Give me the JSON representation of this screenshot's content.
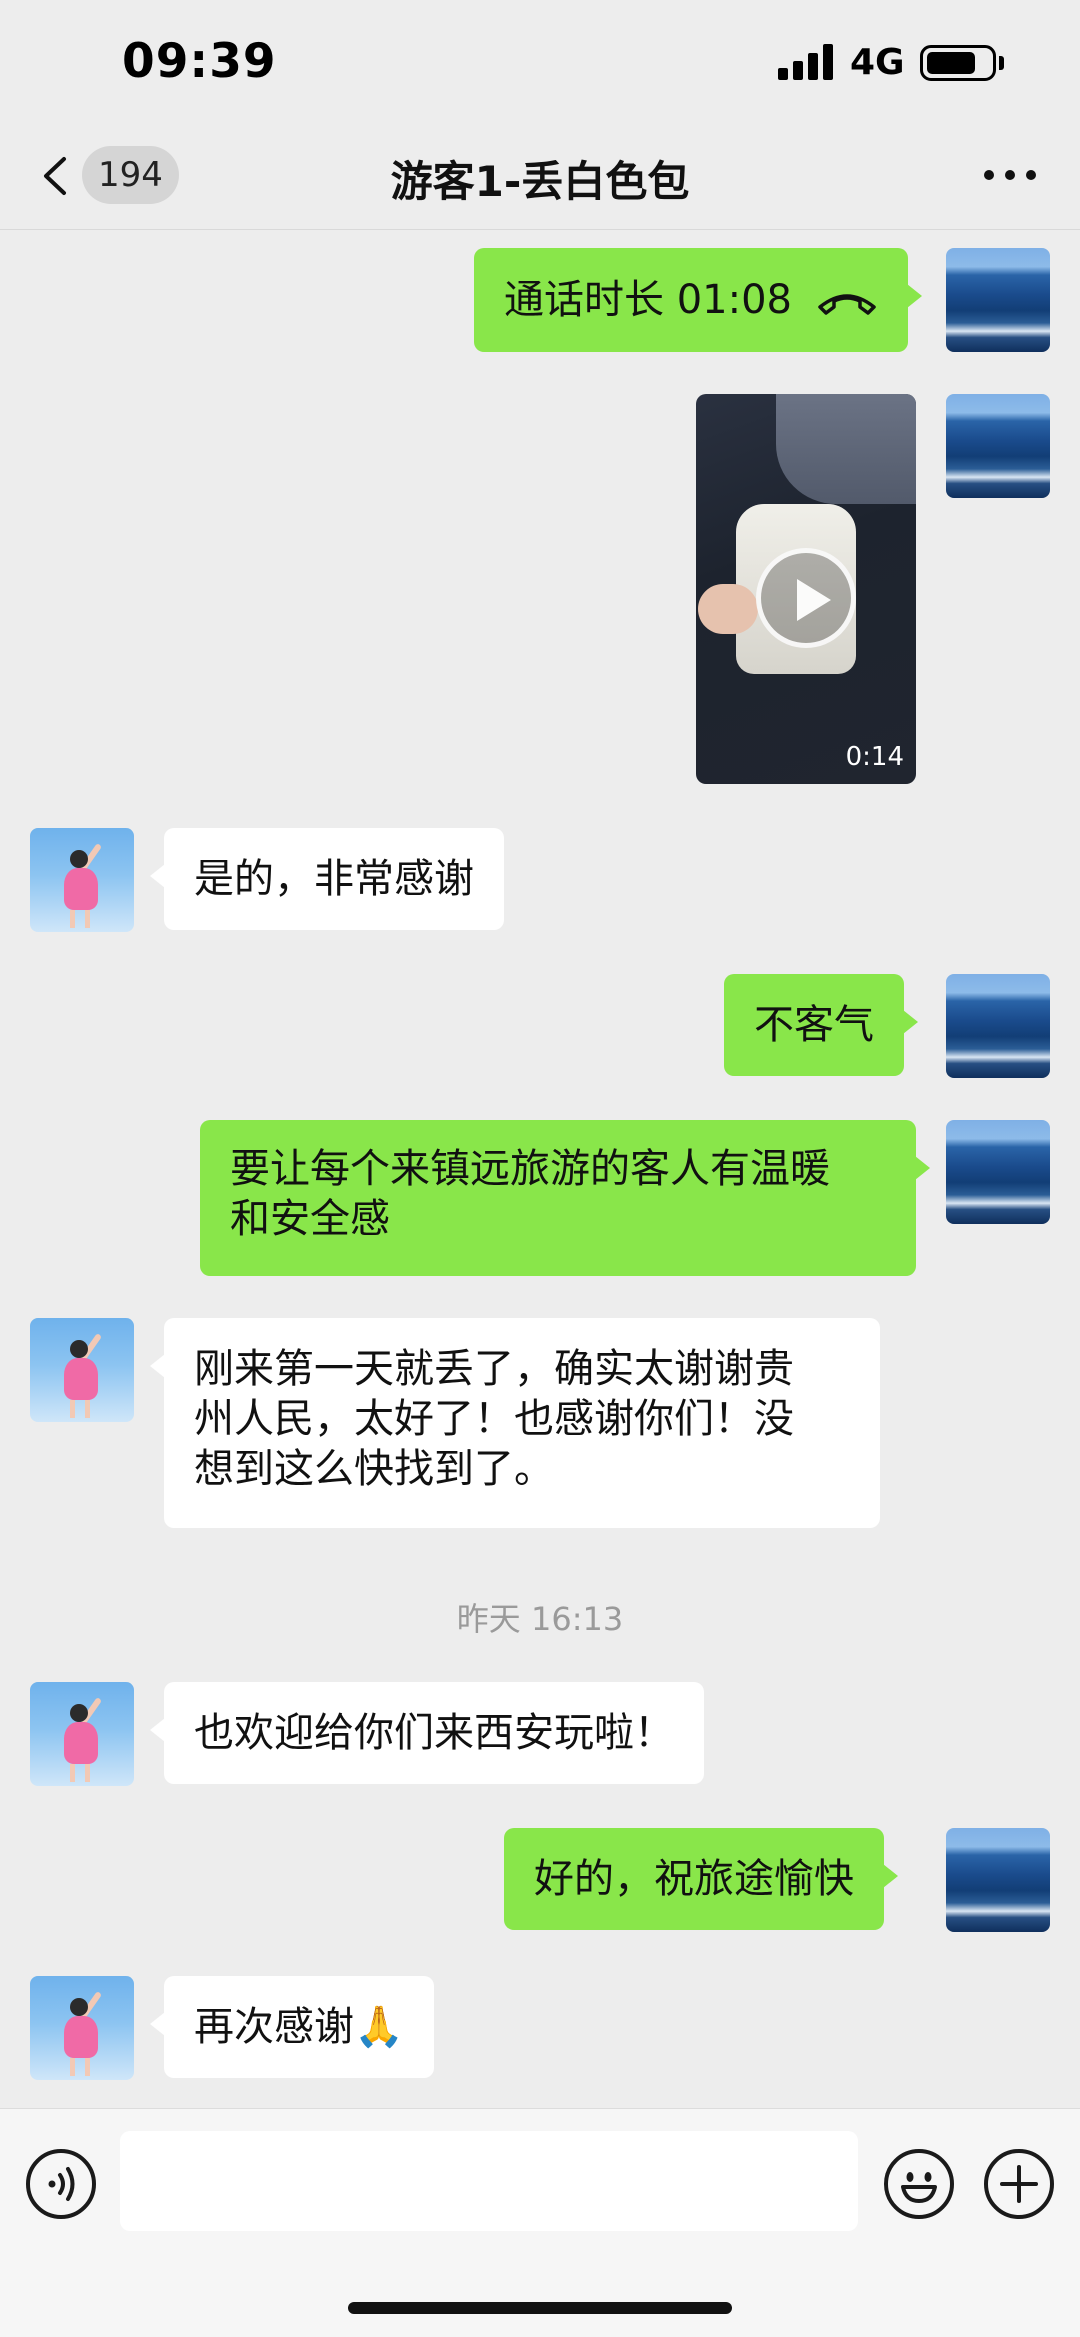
{
  "status_bar": {
    "time": "09:39",
    "network": "4G",
    "battery_level": 0.75
  },
  "nav": {
    "unread_count": "194",
    "title": "游客1-丢白色包",
    "icons": [
      "back-chevron-icon",
      "more-icon"
    ]
  },
  "messages": [
    {
      "side": "right",
      "type": "call",
      "text": "通话时长 01:08",
      "icon": "phone-hangup-icon"
    },
    {
      "side": "right",
      "type": "video",
      "duration": "0:14"
    },
    {
      "side": "left",
      "type": "text",
      "text": "是的，非常感谢"
    },
    {
      "side": "right",
      "type": "text",
      "text": "不客气"
    },
    {
      "side": "right",
      "type": "text",
      "lines": [
        "要让每个来镇远旅游的客人有温暖",
        "和安全感"
      ]
    },
    {
      "side": "left",
      "type": "text",
      "lines": [
        "刚来第一天就丢了，确实太谢谢贵",
        "州人民，太好了！也感谢你们！没",
        "想到这么快找到了。"
      ]
    },
    {
      "type": "timestamp",
      "text": "昨天 16:13"
    },
    {
      "side": "left",
      "type": "text",
      "text": "也欢迎给你们来西安玩啦！"
    },
    {
      "side": "right",
      "type": "text",
      "text": "好的，祝旅途愉快"
    },
    {
      "side": "left",
      "type": "text",
      "text": "再次感谢🙏"
    }
  ],
  "input_bar": {
    "placeholder": "",
    "icons": [
      "voice-icon",
      "emoji-icon",
      "plus-icon"
    ]
  },
  "colors": {
    "background": "#ededed",
    "outgoing_bubble": "#89e64a",
    "incoming_bubble": "#ffffff",
    "timestamp_text": "#9a9a9a"
  }
}
